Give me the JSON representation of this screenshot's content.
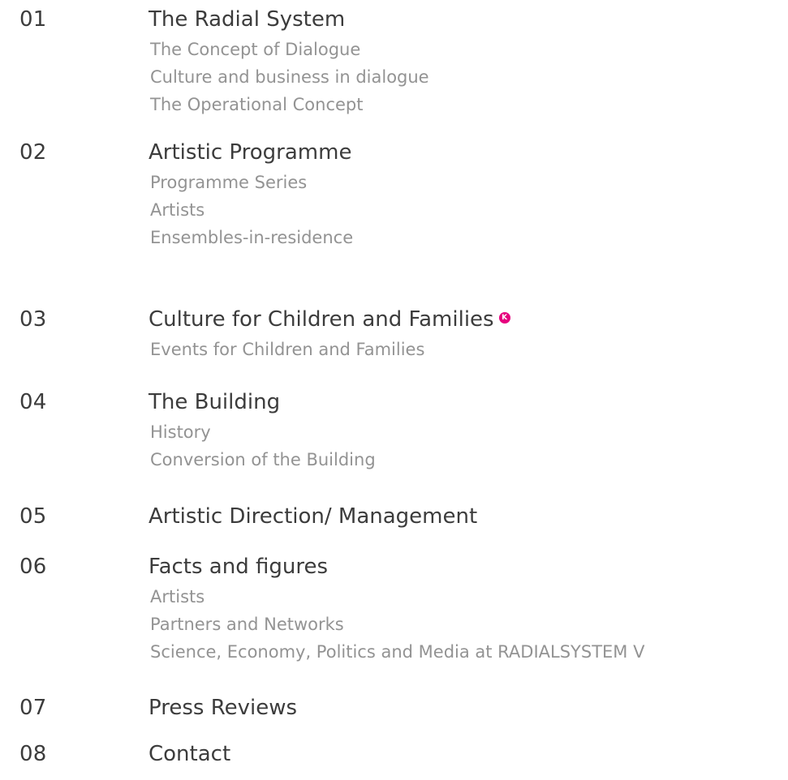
{
  "sections": [
    {
      "number": "01",
      "title": "The Radial System",
      "subitems": [
        "The Concept of Dialogue",
        "Culture and business in dialogue",
        "The Operational Concept"
      ]
    },
    {
      "number": "02",
      "title": "Artistic Programme",
      "subitems": [
        "Programme Series",
        "Artists",
        "Ensembles-in-residence"
      ]
    },
    {
      "number": "03",
      "title": "Culture for Children and Families",
      "badge": "K",
      "subitems": [
        "Events for Children and Families"
      ]
    },
    {
      "number": "04",
      "title": "The Building",
      "subitems": [
        "History",
        "Conversion of the Building"
      ]
    },
    {
      "number": "05",
      "title": "Artistic Direction/ Management",
      "subitems": []
    },
    {
      "number": "06",
      "title": "Facts and figures",
      "subitems": [
        "Artists",
        "Partners and Networks",
        "Science, Economy, Politics and Media at RADIALSYSTEM V"
      ]
    },
    {
      "number": "07",
      "title": "Press Reviews",
      "subitems": []
    },
    {
      "number": "08",
      "title": "Contact",
      "subitems": []
    }
  ],
  "colors": {
    "heading": "#3c3c3c",
    "subitem": "#939393",
    "badge": "#e6007e"
  }
}
